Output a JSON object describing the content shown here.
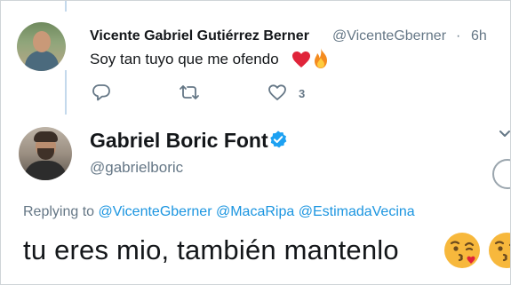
{
  "tweet1": {
    "display_name": "Vicente Gabriel Gutiérrez Berner",
    "handle": "@VicenteGberner",
    "separator": "·",
    "time": "6h",
    "text": "Soy tan tuyo que me ofendo",
    "emojis": [
      "red-heart",
      "fire"
    ],
    "actions": {
      "reply_icon": "reply-icon",
      "retweet_icon": "retweet-icon",
      "like_icon": "heart-icon",
      "like_count": "3"
    }
  },
  "tweet2": {
    "display_name": "Gabriel Boric Font",
    "verified": true,
    "handle": "@gabrielboric",
    "replying_prefix": "Replying to",
    "replying_to": [
      "@VicenteGberner",
      "@MacaRipa",
      "@EstimadaVecina"
    ],
    "text": "tu eres mio, también mantenlo",
    "emojis": [
      "face-blowing-a-kiss",
      "face-blowing-a-kiss"
    ]
  },
  "colors": {
    "text": "#14171a",
    "secondary": "#657786",
    "link": "#1b95e0",
    "verified": "#1da1f2",
    "thread_line": "#c4d9ec"
  }
}
